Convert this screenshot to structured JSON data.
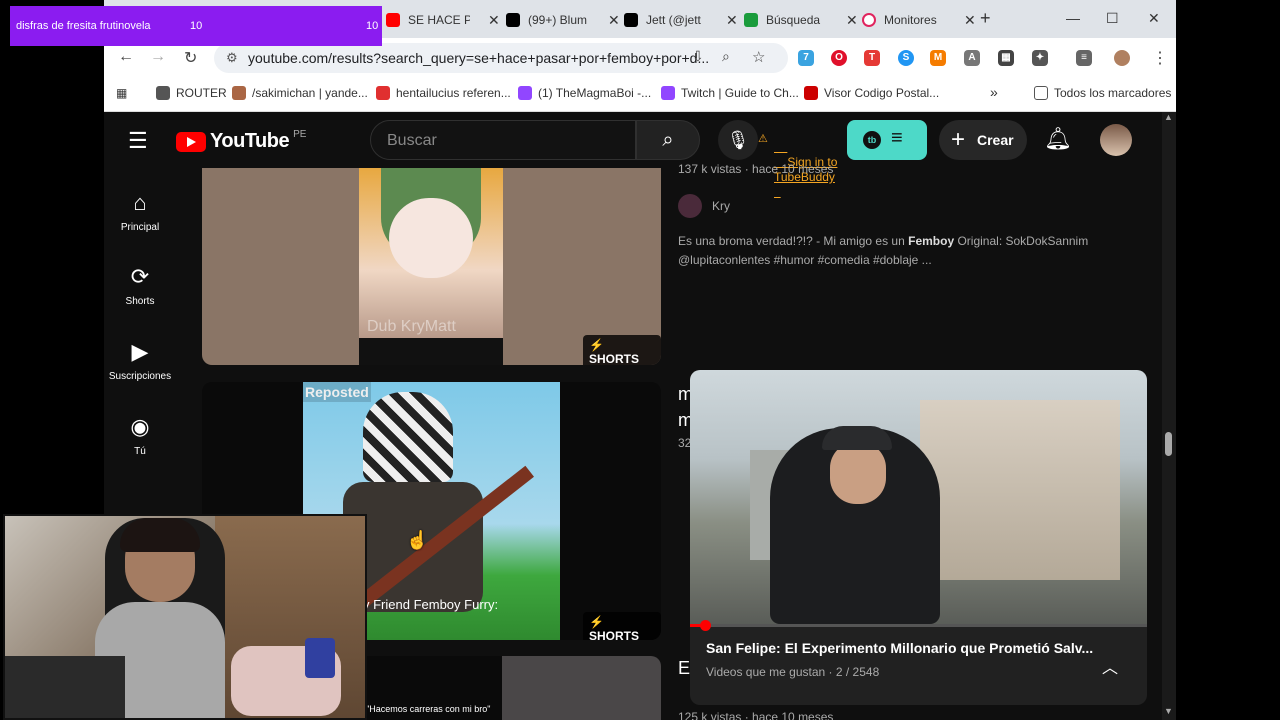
{
  "overlay": {
    "text": "disfras de fresita frutinovela",
    "count_a": "10",
    "count_b": "10"
  },
  "tabs": [
    {
      "label": "SE HACE P",
      "color": "#ff0000"
    },
    {
      "label": "(99+) Blum",
      "color": "#000000"
    },
    {
      "label": "Jett (@jett",
      "color": "#000000"
    },
    {
      "label": "Búsqueda",
      "color": "#1a9c3c"
    },
    {
      "label": "Monitores",
      "color": "#e0245e"
    }
  ],
  "window": {
    "new_tab": "+",
    "minimize": "—",
    "maximize": "☐",
    "close": "✕"
  },
  "omnibox": {
    "url": "youtube.com/results?search_query=se+hace+pasar+por+femboy+por+d..."
  },
  "bookmarks": [
    {
      "label": "ROUTER",
      "color": "#555555"
    },
    {
      "label": "/sakimichan | yande...",
      "color": "#aa6644"
    },
    {
      "label": "hentailucius referen...",
      "color": "#e03030"
    },
    {
      "label": "(1) TheMagmaBoi -...",
      "color": "#9146ff"
    },
    {
      "label": "Twitch | Guide to Ch...",
      "color": "#9146ff"
    },
    {
      "label": "Visor Codigo Postal...",
      "color": "#cc0000"
    }
  ],
  "bookmarks_more": "»",
  "bookmarks_all": "Todos los marcadores",
  "youtube": {
    "logo": "YouTube",
    "region": "PE",
    "search_placeholder": "Buscar",
    "tubebuddy": "Sign in to\nTubeBuddy",
    "create": "Crear",
    "sidebar": [
      {
        "label": "Principal",
        "icon": "home-icon"
      },
      {
        "label": "Shorts",
        "icon": "shorts-icon"
      },
      {
        "label": "Suscripciones",
        "icon": "subscriptions-icon"
      },
      {
        "label": "Tú",
        "icon": "you-icon"
      }
    ],
    "results": [
      {
        "meta": "137 k vistas · hace 10 meses",
        "channel": "Kry",
        "desc_prefix": "Es una broma verdad!?!? - Mi amigo es un ",
        "desc_bold": "Femboy",
        "desc_suffix": " Original: SokDokSannim",
        "desc_line2": "@lupitaconlentes #humor #comedia #doblaje ...",
        "badge": "SHORTS",
        "thumb_caption": "Dub KryMatt"
      },
      {
        "thumb_label": "Reposted",
        "caption": "y Friend Femboy Furry:",
        "badge": "SHORTS",
        "title_partial_1": "m",
        "title_partial_2": "m",
        "meta_partial": "32"
      },
      {
        "title_partial": "E",
        "caption": "\"Hacemos carreras con mi bro\"",
        "meta": "125 k vistas · hace 10 meses"
      }
    ],
    "miniplayer": {
      "title": "San Felipe: El Experimento Millonario que Prometió Salv...",
      "playlist": "Videos que me gustan",
      "position": "2 / 2548"
    }
  }
}
